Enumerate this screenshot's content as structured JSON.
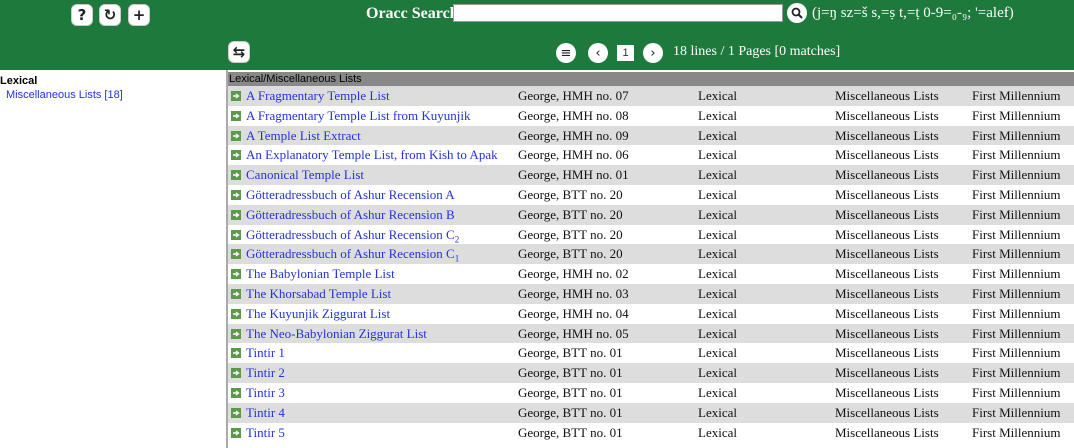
{
  "header": {
    "search_label": "Oracc Search:",
    "search_value": "",
    "search_hint": "(j=ŋ sz=š s,=ṣ t,=ṭ 0-9=₀-₉; '=alef)",
    "icons": [
      "help-icon",
      "reload-icon",
      "plus-icon",
      "search-icon",
      "swap-icon",
      "menu-icon",
      "chevron-left-icon",
      "chevron-right-icon"
    ],
    "page_current": "1",
    "pager_info": "18 lines / 1 Pages [0 matches]"
  },
  "sidebar": {
    "title": "Lexical",
    "link": "Miscellaneous Lists [18]"
  },
  "list": {
    "header": "Lexical/Miscellaneous Lists",
    "rows": [
      {
        "title": "A Fragmentary Temple List",
        "sub": "",
        "pub": "George, HMH no. 07",
        "genre": "Lexical",
        "subgenre": "Miscellaneous Lists",
        "period": "First Millennium"
      },
      {
        "title": "A Fragmentary Temple List from Kuyunjik",
        "sub": "",
        "pub": "George, HMH no. 08",
        "genre": "Lexical",
        "subgenre": "Miscellaneous Lists",
        "period": "First Millennium"
      },
      {
        "title": "A Temple List Extract",
        "sub": "",
        "pub": "George, HMH no. 09",
        "genre": "Lexical",
        "subgenre": "Miscellaneous Lists",
        "period": "First Millennium"
      },
      {
        "title": "An Explanatory Temple List, from Kish to Apak",
        "sub": "",
        "pub": "George, HMH no. 06",
        "genre": "Lexical",
        "subgenre": "Miscellaneous Lists",
        "period": "First Millennium"
      },
      {
        "title": "Canonical Temple List",
        "sub": "",
        "pub": "George, HMH no. 01",
        "genre": "Lexical",
        "subgenre": "Miscellaneous Lists",
        "period": "First Millennium"
      },
      {
        "title": "Götteradressbuch of Ashur Recension A",
        "sub": "",
        "pub": "George, BTT no. 20",
        "genre": "Lexical",
        "subgenre": "Miscellaneous Lists",
        "period": "First Millennium"
      },
      {
        "title": "Götteradressbuch of Ashur Recension B",
        "sub": "",
        "pub": "George, BTT no. 20",
        "genre": "Lexical",
        "subgenre": "Miscellaneous Lists",
        "period": "First Millennium"
      },
      {
        "title": "Götteradressbuch of Ashur Recension C",
        "sub": "2",
        "pub": "George, BTT no. 20",
        "genre": "Lexical",
        "subgenre": "Miscellaneous Lists",
        "period": "First Millennium"
      },
      {
        "title": "Götteradressbuch of Ashur Recension C",
        "sub": "1",
        "pub": "George, BTT no. 20",
        "genre": "Lexical",
        "subgenre": "Miscellaneous Lists",
        "period": "First Millennium"
      },
      {
        "title": "The Babylonian Temple List",
        "sub": "",
        "pub": "George, HMH no. 02",
        "genre": "Lexical",
        "subgenre": "Miscellaneous Lists",
        "period": "First Millennium"
      },
      {
        "title": "The Khorsabad Temple List",
        "sub": "",
        "pub": "George, HMH no. 03",
        "genre": "Lexical",
        "subgenre": "Miscellaneous Lists",
        "period": "First Millennium"
      },
      {
        "title": "The Kuyunjik Ziggurat List",
        "sub": "",
        "pub": "George, HMH no. 04",
        "genre": "Lexical",
        "subgenre": "Miscellaneous Lists",
        "period": "First Millennium"
      },
      {
        "title": "The Neo-Babylonian Ziggurat List",
        "sub": "",
        "pub": "George, HMH no. 05",
        "genre": "Lexical",
        "subgenre": "Miscellaneous Lists",
        "period": "First Millennium"
      },
      {
        "title": "Tintir 1",
        "sub": "",
        "pub": "George, BTT no. 01",
        "genre": "Lexical",
        "subgenre": "Miscellaneous Lists",
        "period": "First Millennium"
      },
      {
        "title": "Tintir 2",
        "sub": "",
        "pub": "George, BTT no. 01",
        "genre": "Lexical",
        "subgenre": "Miscellaneous Lists",
        "period": "First Millennium"
      },
      {
        "title": "Tintir 3",
        "sub": "",
        "pub": "George, BTT no. 01",
        "genre": "Lexical",
        "subgenre": "Miscellaneous Lists",
        "period": "First Millennium"
      },
      {
        "title": "Tintir 4",
        "sub": "",
        "pub": "George, BTT no. 01",
        "genre": "Lexical",
        "subgenre": "Miscellaneous Lists",
        "period": "First Millennium"
      },
      {
        "title": "Tintir 5",
        "sub": "",
        "pub": "George, BTT no. 01",
        "genre": "Lexical",
        "subgenre": "Miscellaneous Lists",
        "period": "First Millennium"
      }
    ]
  }
}
